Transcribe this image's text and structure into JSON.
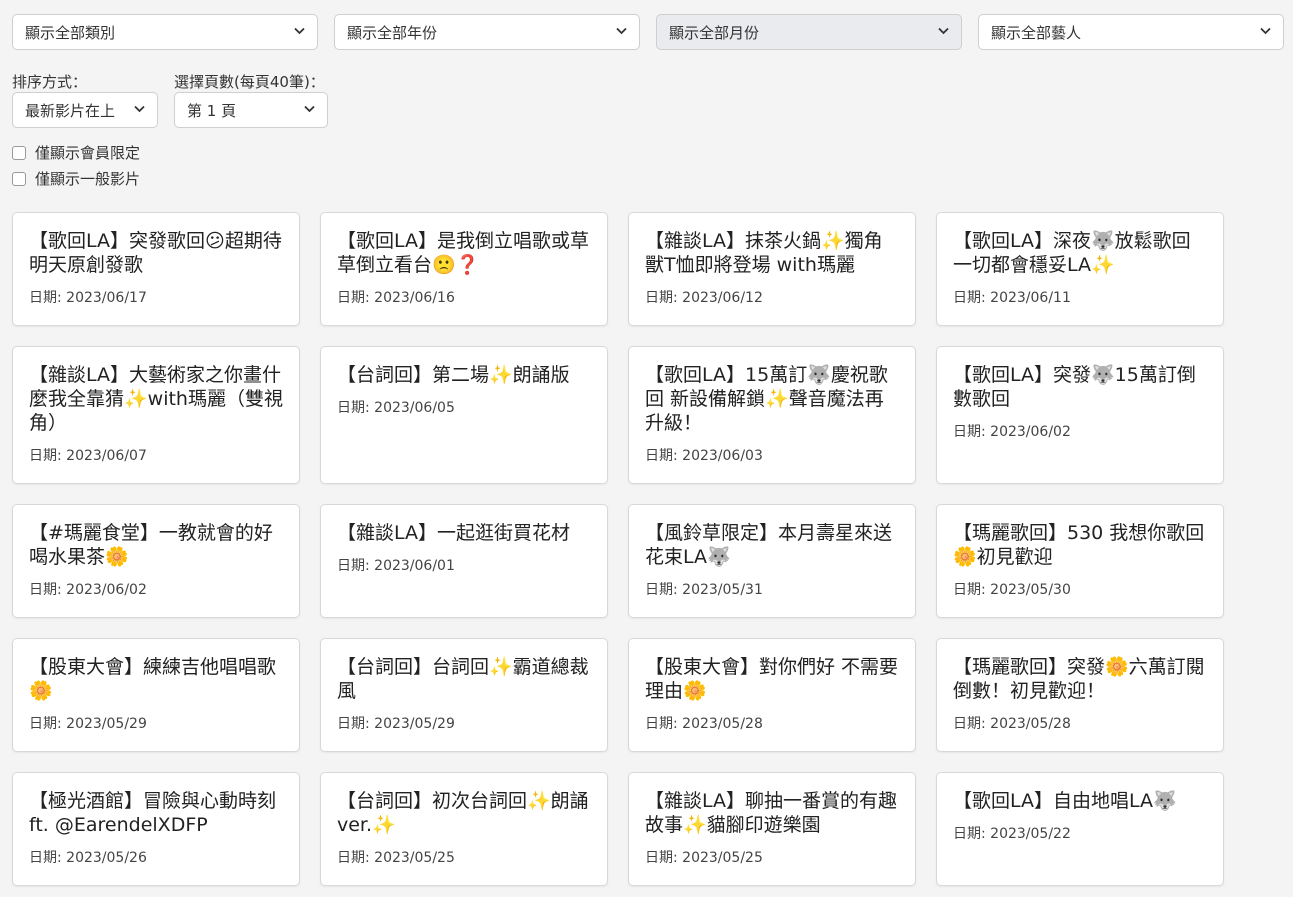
{
  "filters": {
    "category": "顯示全部類別",
    "year": "顯示全部年份",
    "month": "顯示全部月份",
    "artist": "顯示全部藝人"
  },
  "sort": {
    "label": "排序方式：",
    "value": "最新影片在上"
  },
  "page": {
    "label": "選擇頁數(每頁40筆)：",
    "value": "第 1 頁"
  },
  "checkboxes": {
    "members_only": "僅顯示會員限定",
    "general_only": "僅顯示一般影片"
  },
  "videos": [
    {
      "title": "【歌回LA】突發歌回😕超期待明天原創發歌",
      "date": "日期: 2023/06/17"
    },
    {
      "title": "【歌回LA】是我倒立唱歌或草草倒立看台🙁❓",
      "date": "日期: 2023/06/16"
    },
    {
      "title": "【雜談LA】抹茶火鍋✨獨角獸T恤即將登場 with瑪麗",
      "date": "日期: 2023/06/12"
    },
    {
      "title": "【歌回LA】深夜🐺放鬆歌回 一切都會穩妥LA✨",
      "date": "日期: 2023/06/11"
    },
    {
      "title": "【雜談LA】大藝術家之你畫什麼我全靠猜✨with瑪麗（雙視角）",
      "date": "日期: 2023/06/07"
    },
    {
      "title": "【台詞回】第二場✨朗誦版",
      "date": "日期: 2023/06/05"
    },
    {
      "title": "【歌回LA】15萬訂🐺慶祝歌回 新設備解鎖✨聲音魔法再升級！",
      "date": "日期: 2023/06/03"
    },
    {
      "title": "【歌回LA】突發🐺15萬訂倒數歌回",
      "date": "日期: 2023/06/02"
    },
    {
      "title": "【#瑪麗食堂】一教就會的好喝水果茶🌼",
      "date": "日期: 2023/06/02"
    },
    {
      "title": "【雜談LA】一起逛街買花材",
      "date": "日期: 2023/06/01"
    },
    {
      "title": "【風鈴草限定】本月壽星來送花束LA🐺",
      "date": "日期: 2023/05/31"
    },
    {
      "title": "【瑪麗歌回】530 我想你歌回🌼初見歡迎",
      "date": "日期: 2023/05/30"
    },
    {
      "title": "【股東大會】練練吉他唱唱歌🌼",
      "date": "日期: 2023/05/29"
    },
    {
      "title": "【台詞回】台詞回✨霸道總裁風",
      "date": "日期: 2023/05/29"
    },
    {
      "title": "【股東大會】對你們好 不需要理由🌼",
      "date": "日期: 2023/05/28"
    },
    {
      "title": "【瑪麗歌回】突發🌼六萬訂閱倒數！初見歡迎！",
      "date": "日期: 2023/05/28"
    },
    {
      "title": "【極光酒館】冒險與心動時刻 ft. @EarendelXDFP",
      "date": "日期: 2023/05/26"
    },
    {
      "title": "【台詞回】初次台詞回✨朗誦ver.✨",
      "date": "日期: 2023/05/25"
    },
    {
      "title": "【雜談LA】聊抽一番賞的有趣故事✨貓腳印遊樂園",
      "date": "日期: 2023/05/25"
    },
    {
      "title": "【歌回LA】自由地唱LA🐺",
      "date": "日期: 2023/05/22"
    }
  ]
}
